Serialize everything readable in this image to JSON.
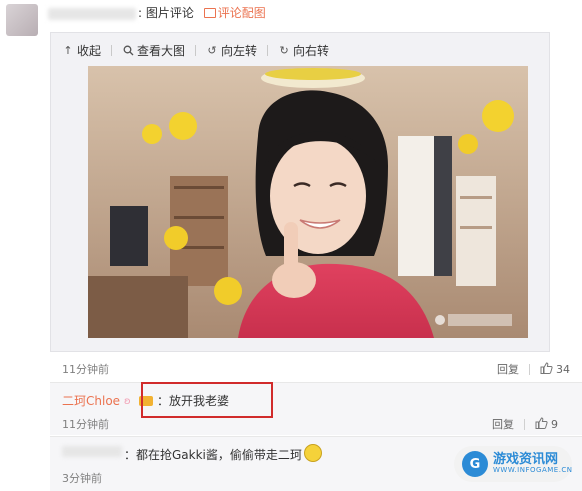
{
  "comment": {
    "separator": ":",
    "type_label": "图片评论",
    "link_label": "评论配图"
  },
  "toolbar": {
    "collapse": "收起",
    "view_large": "查看大图",
    "rotate_left": "向左转",
    "rotate_right": "向右转"
  },
  "post": {
    "time": "11分钟前",
    "reply_label": "回复",
    "likes": "34"
  },
  "replies": [
    {
      "name": "二珂Chloe",
      "text": "：放开我老婆",
      "time": "11分钟前",
      "reply_label": "回复",
      "likes": "9"
    },
    {
      "text": "：都在抢Gakki酱，偷偷带走二珂",
      "time": "3分钟前"
    }
  ],
  "logo": {
    "letter": "G",
    "main": "游戏资讯网",
    "sub": "WWW.INFOGAME.CN"
  },
  "colors": {
    "accent": "#eb7350",
    "highlight_box": "#d12b2b",
    "logo_blue": "#2c8bd6"
  }
}
